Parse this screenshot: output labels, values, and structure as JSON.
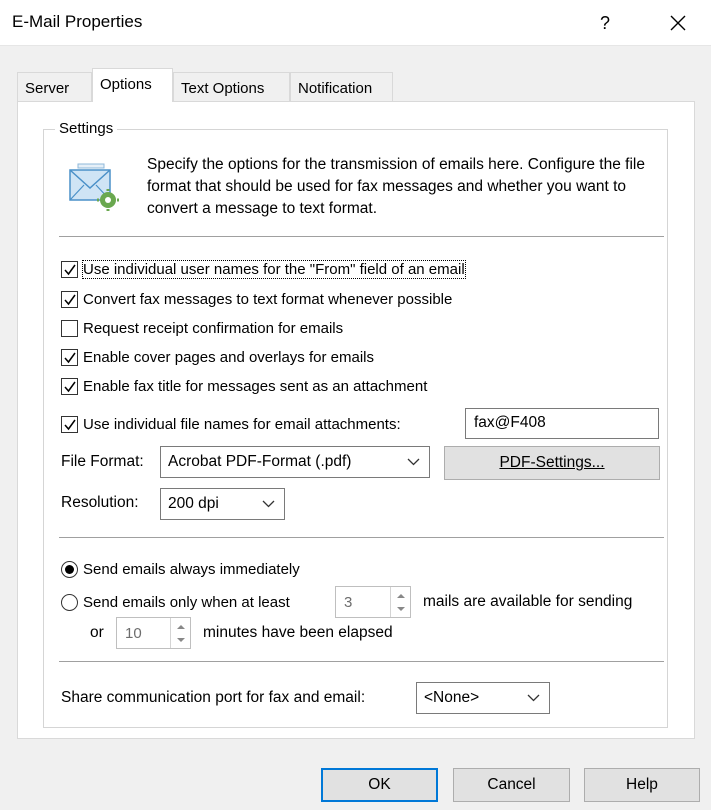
{
  "window": {
    "title": "E-Mail Properties",
    "help_symbol": "?"
  },
  "tabs": [
    {
      "label": "Server",
      "active": false
    },
    {
      "label": "Options",
      "active": true
    },
    {
      "label": "Text Options",
      "active": false
    },
    {
      "label": "Notification",
      "active": false
    }
  ],
  "settings": {
    "group_label": "Settings",
    "description": "Specify the options for the transmission of emails here. Configure the file format that should be used for fax messages and whether you want to convert a message to text format."
  },
  "checkboxes": [
    {
      "label": "Use individual user names for the \"From\" field of an email",
      "checked": true
    },
    {
      "label": "Convert fax messages to text format whenever possible",
      "checked": true
    },
    {
      "label": "Request receipt confirmation for emails",
      "checked": false
    },
    {
      "label": "Enable cover pages and overlays for emails",
      "checked": true
    },
    {
      "label": "Enable fax title for messages sent as an attachment",
      "checked": true
    }
  ],
  "attachments": {
    "label": "Use individual file names for email attachments:",
    "checked": true,
    "value": "fax@F408"
  },
  "file_format": {
    "label": "File Format:",
    "selected": "Acrobat PDF-Format (.pdf)",
    "settings_button": "PDF-Settings..."
  },
  "resolution": {
    "label": "Resolution:",
    "selected": "200 dpi"
  },
  "sending": {
    "immediate_label": "Send emails always immediately",
    "threshold_label": "Send emails only when at least",
    "threshold_value": "3",
    "threshold_suffix": "mails are available for sending",
    "or_label": "or",
    "minutes_value": "10",
    "minutes_suffix": "minutes have been elapsed",
    "selected": "immediate"
  },
  "share_port": {
    "label": "Share communication port for fax and email:",
    "selected": "<None>"
  },
  "buttons": {
    "ok": "OK",
    "cancel": "Cancel",
    "help": "Help"
  },
  "colors": {
    "accent": "#0078d7",
    "icon_blue": "#4a90c8",
    "icon_green": "#6aa84f"
  }
}
